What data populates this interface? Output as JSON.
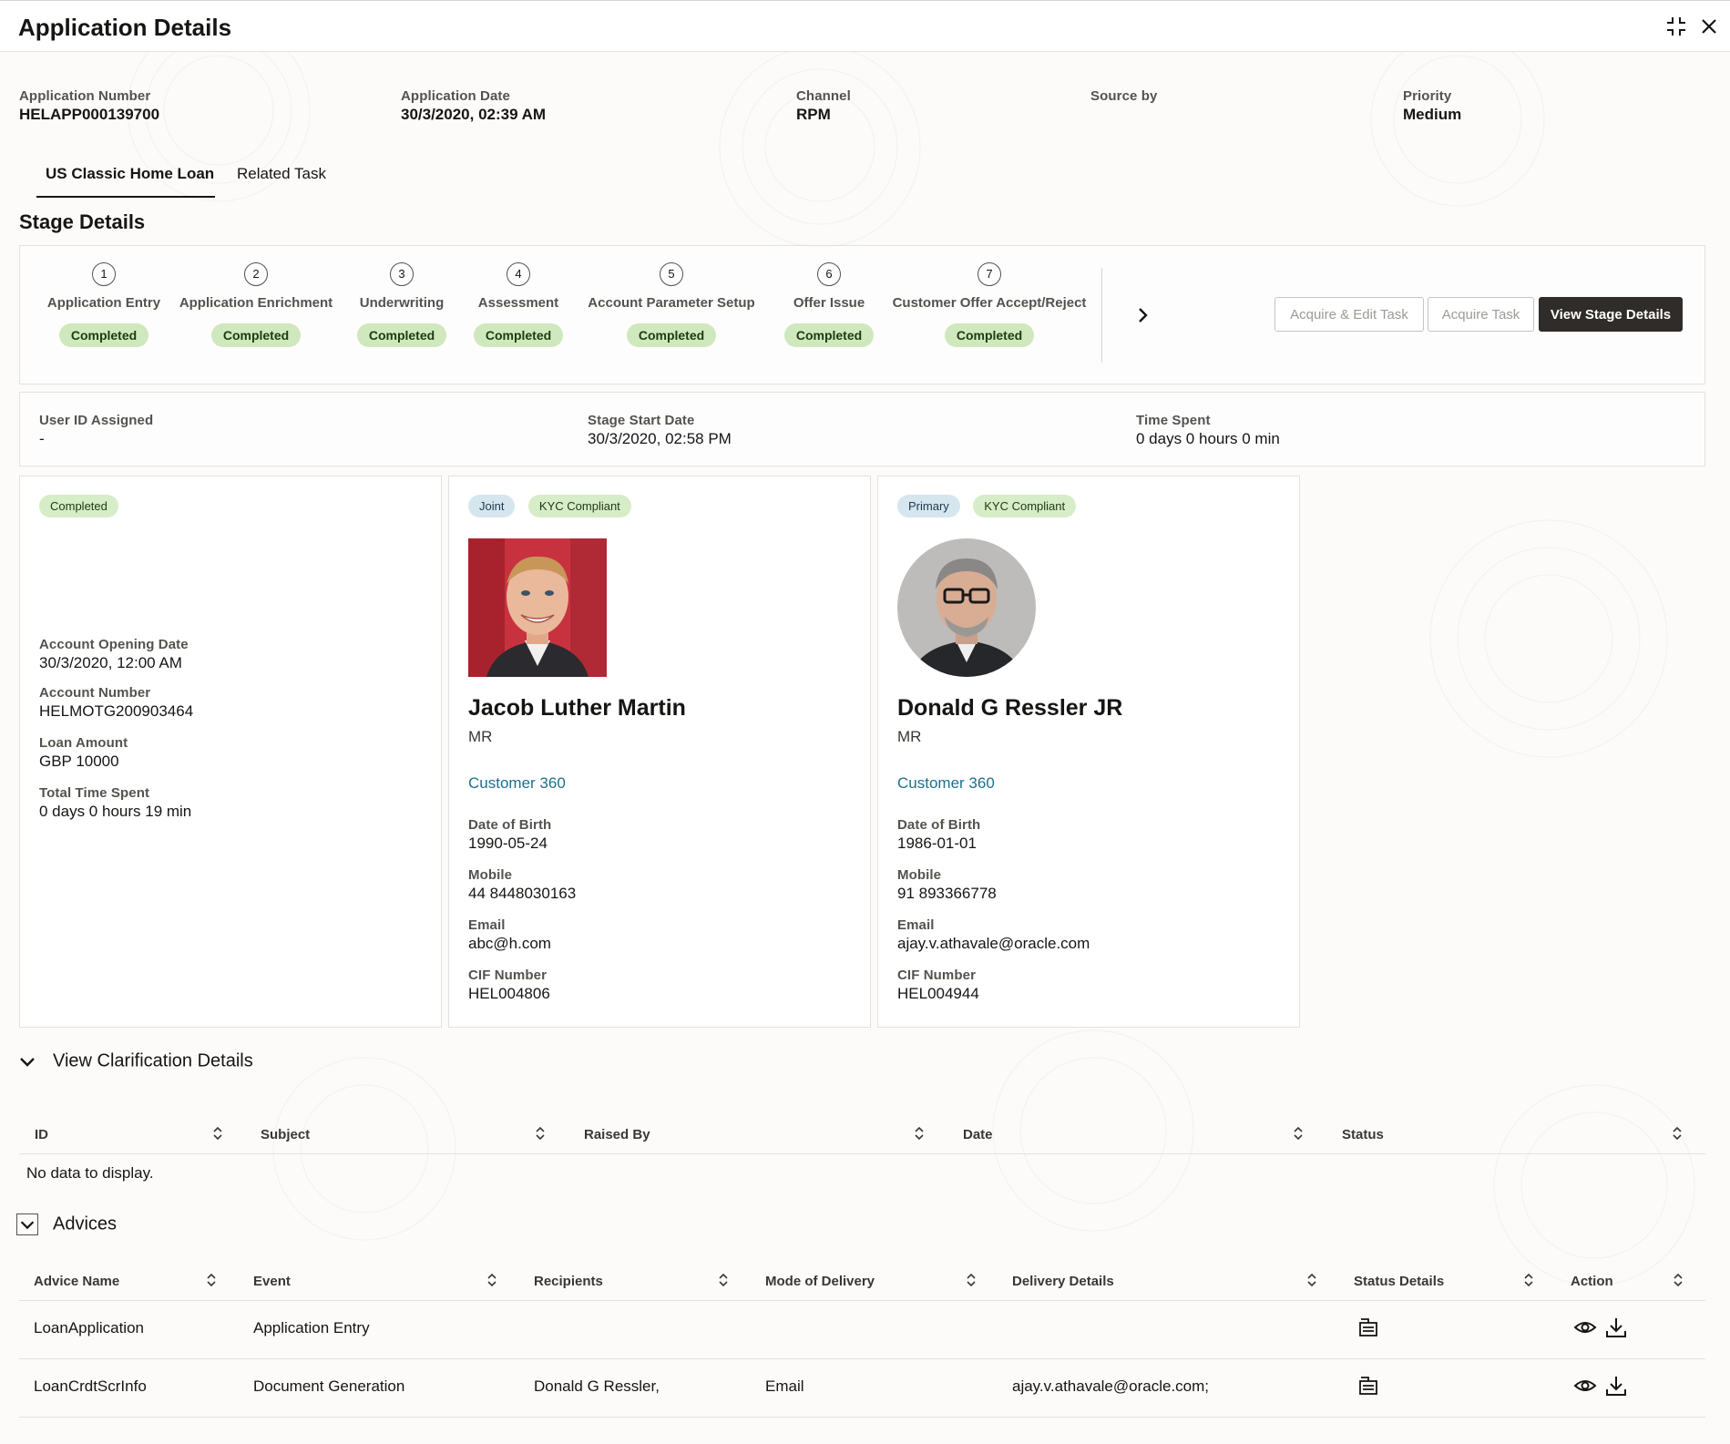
{
  "window": {
    "title": "Application Details"
  },
  "header": {
    "application_number": {
      "label": "Application Number",
      "value": "HELAPP000139700"
    },
    "application_date": {
      "label": "Application Date",
      "value": "30/3/2020, 02:39 AM"
    },
    "channel": {
      "label": "Channel",
      "value": "RPM"
    },
    "source_by": {
      "label": "Source by",
      "value": ""
    },
    "priority": {
      "label": "Priority",
      "value": "Medium"
    }
  },
  "tabs": [
    {
      "label": "US Classic Home Loan",
      "active": true
    },
    {
      "label": "Related Task",
      "active": false
    }
  ],
  "stage_details": {
    "title": "Stage Details",
    "stages": [
      {
        "num": "1",
        "name": "Application Entry",
        "status": "Completed"
      },
      {
        "num": "2",
        "name": "Application Enrichment",
        "status": "Completed"
      },
      {
        "num": "3",
        "name": "Underwriting",
        "status": "Completed"
      },
      {
        "num": "4",
        "name": "Assessment",
        "status": "Completed"
      },
      {
        "num": "5",
        "name": "Account Parameter Setup",
        "status": "Completed"
      },
      {
        "num": "6",
        "name": "Offer Issue",
        "status": "Completed"
      },
      {
        "num": "7",
        "name": "Customer Offer Accept/Reject",
        "status": "Completed"
      }
    ],
    "buttons": {
      "acquire_edit": "Acquire & Edit Task",
      "acquire": "Acquire Task",
      "view_stage": "View Stage Details"
    }
  },
  "stage_info": {
    "user_id": {
      "label": "User ID Assigned",
      "value": "-"
    },
    "start_date": {
      "label": "Stage Start Date",
      "value": "30/3/2020, 02:58 PM"
    },
    "time_spent": {
      "label": "Time Spent",
      "value": "0 days 0 hours 0 min"
    }
  },
  "account_card": {
    "status": "Completed",
    "opening_date": {
      "label": "Account Opening Date",
      "value": "30/3/2020, 12:00 AM"
    },
    "account_number": {
      "label": "Account Number",
      "value": "HELMOTG200903464"
    },
    "loan_amount": {
      "label": "Loan Amount",
      "value": "GBP 10000"
    },
    "total_time": {
      "label": "Total Time Spent",
      "value": "0 days 0 hours 19 min"
    }
  },
  "customers": [
    {
      "type": "Joint",
      "kyc": "KYC Compliant",
      "name": "Jacob Luther Martin",
      "salutation": "MR",
      "link": "Customer 360",
      "dob": {
        "label": "Date of Birth",
        "value": "1990-05-24"
      },
      "mobile": {
        "label": "Mobile",
        "value": "44 8448030163"
      },
      "email": {
        "label": "Email",
        "value": "abc@h.com"
      },
      "cif": {
        "label": "CIF Number",
        "value": "HEL004806"
      }
    },
    {
      "type": "Primary",
      "kyc": "KYC Compliant",
      "name": "Donald G Ressler JR",
      "salutation": "MR",
      "link": "Customer 360",
      "dob": {
        "label": "Date of Birth",
        "value": "1986-01-01"
      },
      "mobile": {
        "label": "Mobile",
        "value": "91 893366778"
      },
      "email": {
        "label": "Email",
        "value": "ajay.v.athavale@oracle.com"
      },
      "cif": {
        "label": "CIF Number",
        "value": "HEL004944"
      }
    }
  ],
  "clarification": {
    "title": "View Clarification Details",
    "columns": [
      "ID",
      "Subject",
      "Raised By",
      "Date",
      "Status"
    ],
    "empty": "No data to display."
  },
  "advices": {
    "title": "Advices",
    "columns": [
      "Advice Name",
      "Event",
      "Recipients",
      "Mode of Delivery",
      "Delivery Details",
      "Status Details",
      "Action"
    ],
    "rows": [
      {
        "name": "LoanApplication",
        "event": "Application Entry",
        "recipients": "",
        "mode": "",
        "details": ""
      },
      {
        "name": "LoanCrdtScrInfo",
        "event": "Document Generation",
        "recipients": "Donald G Ressler,",
        "mode": "Email",
        "details": "ajay.v.athavale@oracle.com;"
      }
    ]
  },
  "icons": {
    "collapse": "collapse-icon",
    "close": "close-icon",
    "next": "chevron-right-icon",
    "expand_section": "chevron-down-icon",
    "sort": "sort-icon",
    "status_details": "status-details-icon",
    "view": "eye-icon",
    "download": "download-icon"
  },
  "colors": {
    "completed_badge": "#cfe8bd",
    "primary_button": "#2f2c29",
    "link": "#1e6f8f",
    "role_badge": "#d6e6ef"
  }
}
